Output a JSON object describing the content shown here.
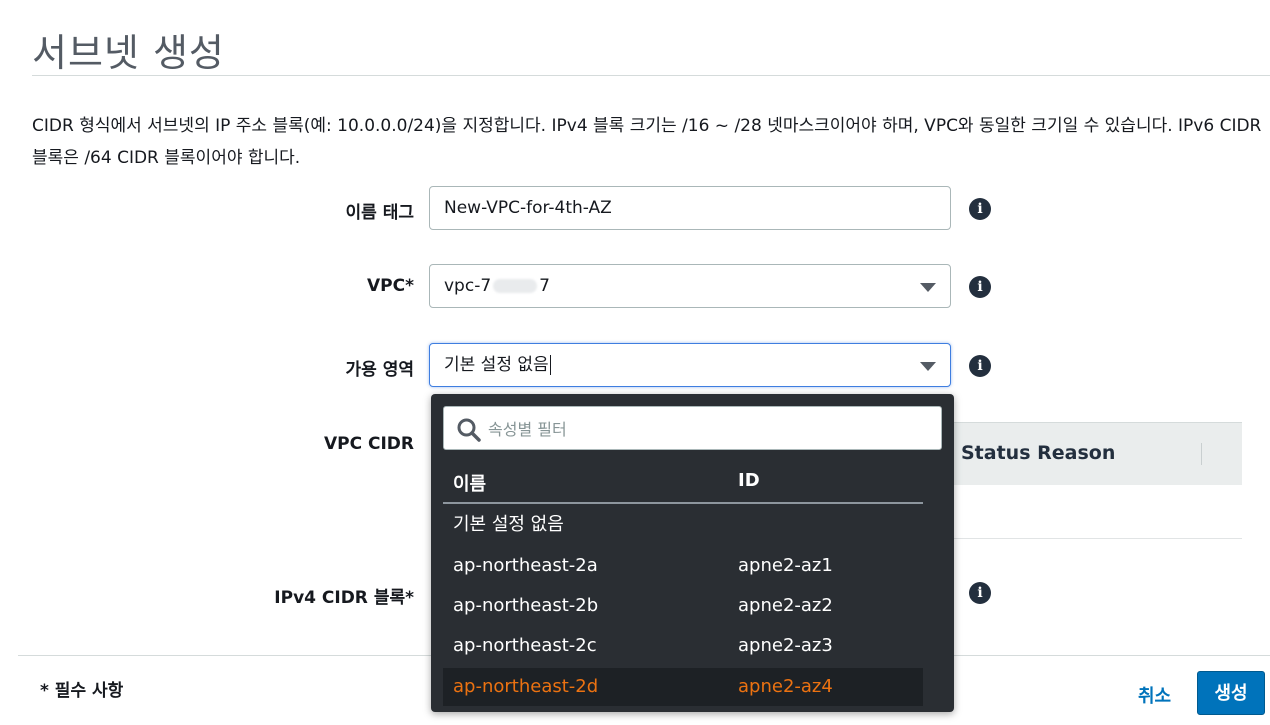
{
  "page": {
    "title": "서브넷 생성",
    "description": "CIDR 형식에서 서브넷의 IP 주소 블록(예: 10.0.0.0/24)을 지정합니다. IPv4 블록 크기는 /16 ~ /28 넷마스크이어야 하며, VPC와 동일한 크기일 수 있습니다. IPv6 CIDR 블록은 /64 CIDR 블록이어야 합니다."
  },
  "form": {
    "name_tag_label": "이름 태그",
    "name_tag_value": "New-VPC-for-4th-AZ",
    "vpc_label": "VPC*",
    "vpc_value_prefix": "vpc-7",
    "vpc_value_suffix": "7",
    "az_label": "가용 영역",
    "az_value": "기본 설정 없음",
    "vpc_cidr_label": "VPC CIDR",
    "ipv4_cidr_label": "IPv4 CIDR 블록*",
    "info_icon_glyph": "i"
  },
  "cidr_table": {
    "headers": [
      "Status Reason"
    ]
  },
  "dropdown": {
    "filter_placeholder": "속성별 필터",
    "columns": [
      "이름",
      "ID"
    ],
    "options": [
      {
        "name": "기본 설정 없음",
        "id": ""
      },
      {
        "name": "ap-northeast-2a",
        "id": "apne2-az1"
      },
      {
        "name": "ap-northeast-2b",
        "id": "apne2-az2"
      },
      {
        "name": "ap-northeast-2c",
        "id": "apne2-az3"
      },
      {
        "name": "ap-northeast-2d",
        "id": "apne2-az4"
      }
    ],
    "highlighted_index": 4
  },
  "footer": {
    "required_note": "* 필수 사항",
    "cancel_label": "취소",
    "create_label": "생성"
  },
  "colors": {
    "primary": "#0073bb",
    "highlight": "#ec7211",
    "dropdown_bg": "#2a2e33"
  }
}
